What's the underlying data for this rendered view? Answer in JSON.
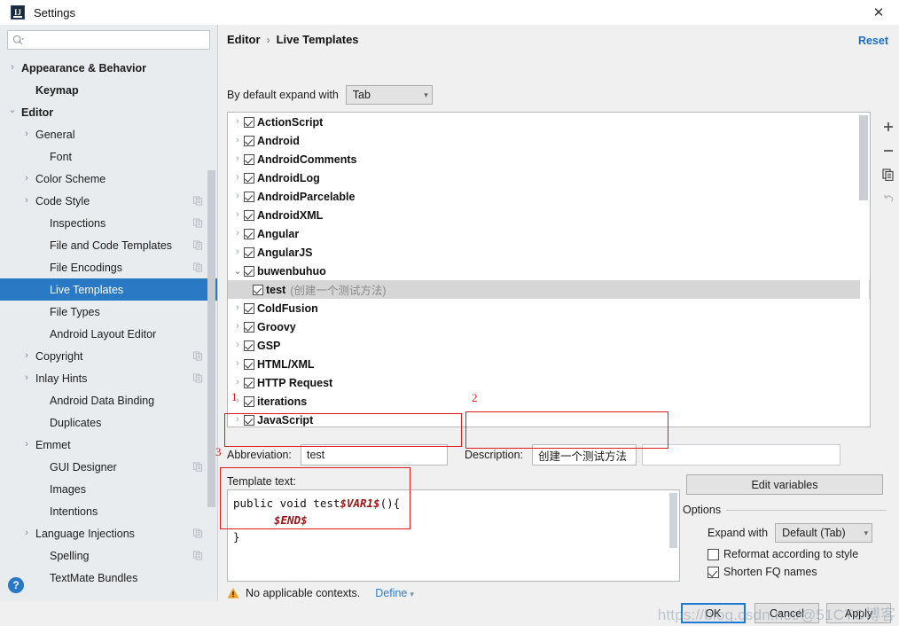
{
  "window": {
    "title": "Settings",
    "app_icon": "intellij-idea-icon",
    "close_icon": "close-icon"
  },
  "sidebar": {
    "search": {
      "placeholder": "",
      "value": "",
      "icon": "search-icon"
    },
    "items": [
      {
        "label": "Appearance & Behavior",
        "arrow": "right",
        "bold": true,
        "indent": 0,
        "copy": false,
        "selected": false
      },
      {
        "label": "Keymap",
        "arrow": "none",
        "bold": true,
        "indent": 1,
        "copy": false,
        "selected": false
      },
      {
        "label": "Editor",
        "arrow": "down",
        "bold": true,
        "indent": 0,
        "copy": false,
        "selected": false
      },
      {
        "label": "General",
        "arrow": "right",
        "bold": false,
        "indent": 1,
        "copy": false,
        "selected": false
      },
      {
        "label": "Font",
        "arrow": "none",
        "bold": false,
        "indent": 2,
        "copy": false,
        "selected": false
      },
      {
        "label": "Color Scheme",
        "arrow": "right",
        "bold": false,
        "indent": 1,
        "copy": false,
        "selected": false
      },
      {
        "label": "Code Style",
        "arrow": "right",
        "bold": false,
        "indent": 1,
        "copy": true,
        "selected": false
      },
      {
        "label": "Inspections",
        "arrow": "none",
        "bold": false,
        "indent": 2,
        "copy": true,
        "selected": false
      },
      {
        "label": "File and Code Templates",
        "arrow": "none",
        "bold": false,
        "indent": 2,
        "copy": true,
        "selected": false
      },
      {
        "label": "File Encodings",
        "arrow": "none",
        "bold": false,
        "indent": 2,
        "copy": true,
        "selected": false
      },
      {
        "label": "Live Templates",
        "arrow": "none",
        "bold": false,
        "indent": 2,
        "copy": false,
        "selected": true
      },
      {
        "label": "File Types",
        "arrow": "none",
        "bold": false,
        "indent": 2,
        "copy": false,
        "selected": false
      },
      {
        "label": "Android Layout Editor",
        "arrow": "none",
        "bold": false,
        "indent": 2,
        "copy": false,
        "selected": false
      },
      {
        "label": "Copyright",
        "arrow": "right",
        "bold": false,
        "indent": 1,
        "copy": true,
        "selected": false
      },
      {
        "label": "Inlay Hints",
        "arrow": "right",
        "bold": false,
        "indent": 1,
        "copy": true,
        "selected": false
      },
      {
        "label": "Android Data Binding",
        "arrow": "none",
        "bold": false,
        "indent": 2,
        "copy": false,
        "selected": false
      },
      {
        "label": "Duplicates",
        "arrow": "none",
        "bold": false,
        "indent": 2,
        "copy": false,
        "selected": false
      },
      {
        "label": "Emmet",
        "arrow": "right",
        "bold": false,
        "indent": 1,
        "copy": false,
        "selected": false
      },
      {
        "label": "GUI Designer",
        "arrow": "none",
        "bold": false,
        "indent": 2,
        "copy": true,
        "selected": false
      },
      {
        "label": "Images",
        "arrow": "none",
        "bold": false,
        "indent": 2,
        "copy": false,
        "selected": false
      },
      {
        "label": "Intentions",
        "arrow": "none",
        "bold": false,
        "indent": 2,
        "copy": false,
        "selected": false
      },
      {
        "label": "Language Injections",
        "arrow": "right",
        "bold": false,
        "indent": 1,
        "copy": true,
        "selected": false
      },
      {
        "label": "Spelling",
        "arrow": "none",
        "bold": false,
        "indent": 2,
        "copy": true,
        "selected": false
      },
      {
        "label": "TextMate Bundles",
        "arrow": "none",
        "bold": false,
        "indent": 2,
        "copy": false,
        "selected": false
      }
    ],
    "help_icon": "help-icon",
    "help_label": "?"
  },
  "main": {
    "breadcrumb": {
      "parent": "Editor",
      "separator": "›",
      "current": "Live Templates"
    },
    "reset_label": "Reset",
    "expand_with": {
      "label": "By default expand with",
      "value": "Tab",
      "chevron_icon": "chevron-down-icon"
    },
    "template_list": [
      {
        "name": "ActionScript",
        "desc": "",
        "arrow": "right",
        "checked": true,
        "child": false,
        "selected": false
      },
      {
        "name": "Android",
        "desc": "",
        "arrow": "right",
        "checked": true,
        "child": false,
        "selected": false
      },
      {
        "name": "AndroidComments",
        "desc": "",
        "arrow": "right",
        "checked": true,
        "child": false,
        "selected": false
      },
      {
        "name": "AndroidLog",
        "desc": "",
        "arrow": "right",
        "checked": true,
        "child": false,
        "selected": false
      },
      {
        "name": "AndroidParcelable",
        "desc": "",
        "arrow": "right",
        "checked": true,
        "child": false,
        "selected": false
      },
      {
        "name": "AndroidXML",
        "desc": "",
        "arrow": "right",
        "checked": true,
        "child": false,
        "selected": false
      },
      {
        "name": "Angular",
        "desc": "",
        "arrow": "right",
        "checked": true,
        "child": false,
        "selected": false
      },
      {
        "name": "AngularJS",
        "desc": "",
        "arrow": "right",
        "checked": true,
        "child": false,
        "selected": false
      },
      {
        "name": "buwenbuhuo",
        "desc": "",
        "arrow": "down",
        "checked": true,
        "child": false,
        "selected": false
      },
      {
        "name": "test",
        "desc": "(创建一个测试方法)",
        "arrow": "none",
        "checked": true,
        "child": true,
        "selected": true
      },
      {
        "name": "ColdFusion",
        "desc": "",
        "arrow": "right",
        "checked": true,
        "child": false,
        "selected": false
      },
      {
        "name": "Groovy",
        "desc": "",
        "arrow": "right",
        "checked": true,
        "child": false,
        "selected": false
      },
      {
        "name": "GSP",
        "desc": "",
        "arrow": "right",
        "checked": true,
        "child": false,
        "selected": false
      },
      {
        "name": "HTML/XML",
        "desc": "",
        "arrow": "right",
        "checked": true,
        "child": false,
        "selected": false
      },
      {
        "name": "HTTP Request",
        "desc": "",
        "arrow": "right",
        "checked": true,
        "child": false,
        "selected": false
      },
      {
        "name": "iterations",
        "desc": "",
        "arrow": "right",
        "checked": true,
        "child": false,
        "selected": false
      },
      {
        "name": "JavaScript",
        "desc": "",
        "arrow": "right",
        "checked": true,
        "child": false,
        "selected": false
      }
    ],
    "list_toolbar": [
      {
        "icon": "plus-icon",
        "name": "add-template-button",
        "disabled": false
      },
      {
        "icon": "minus-icon",
        "name": "remove-template-button",
        "disabled": false
      },
      {
        "icon": "duplicate-icon",
        "name": "duplicate-template-button",
        "disabled": false
      },
      {
        "icon": "revert-icon",
        "name": "revert-template-button",
        "disabled": true
      }
    ],
    "abbreviation": {
      "label": "Abbreviation:",
      "value": "test"
    },
    "description": {
      "label": "Description:",
      "value": "创建一个测试方法"
    },
    "template_text": {
      "label": "Template text:",
      "line1_pre": "public void test",
      "line1_var": "$VAR1$",
      "line1_post": "(){",
      "line2_var": "$END$",
      "line3": "}"
    },
    "edit_variables_label": "Edit variables",
    "options": {
      "legend": "Options",
      "expand_with_label": "Expand with",
      "expand_with_value": "Default (Tab)",
      "reformat": {
        "label": "Reformat according to style",
        "checked": false
      },
      "shorten": {
        "label": "Shorten FQ names",
        "checked": true
      }
    },
    "warning": {
      "icon": "warning-icon",
      "text": "No applicable contexts.",
      "define_label": "Define",
      "define_chevron": "chevron-down-icon"
    }
  },
  "footer": {
    "ok_label": "OK",
    "cancel_label": "Cancel",
    "apply_label": "Apply"
  },
  "annotations": {
    "n1": "1",
    "n2": "2",
    "n3": "3"
  },
  "watermark": {
    "text": "https://blog.csdn.net/@51CTO博客"
  },
  "colors": {
    "accent_blue": "#2a79c4",
    "link_blue": "#1a6fc4",
    "annotation_red": "#e01b1b",
    "variable_red": "#9c1616",
    "warning_amber": "#f0a020"
  }
}
